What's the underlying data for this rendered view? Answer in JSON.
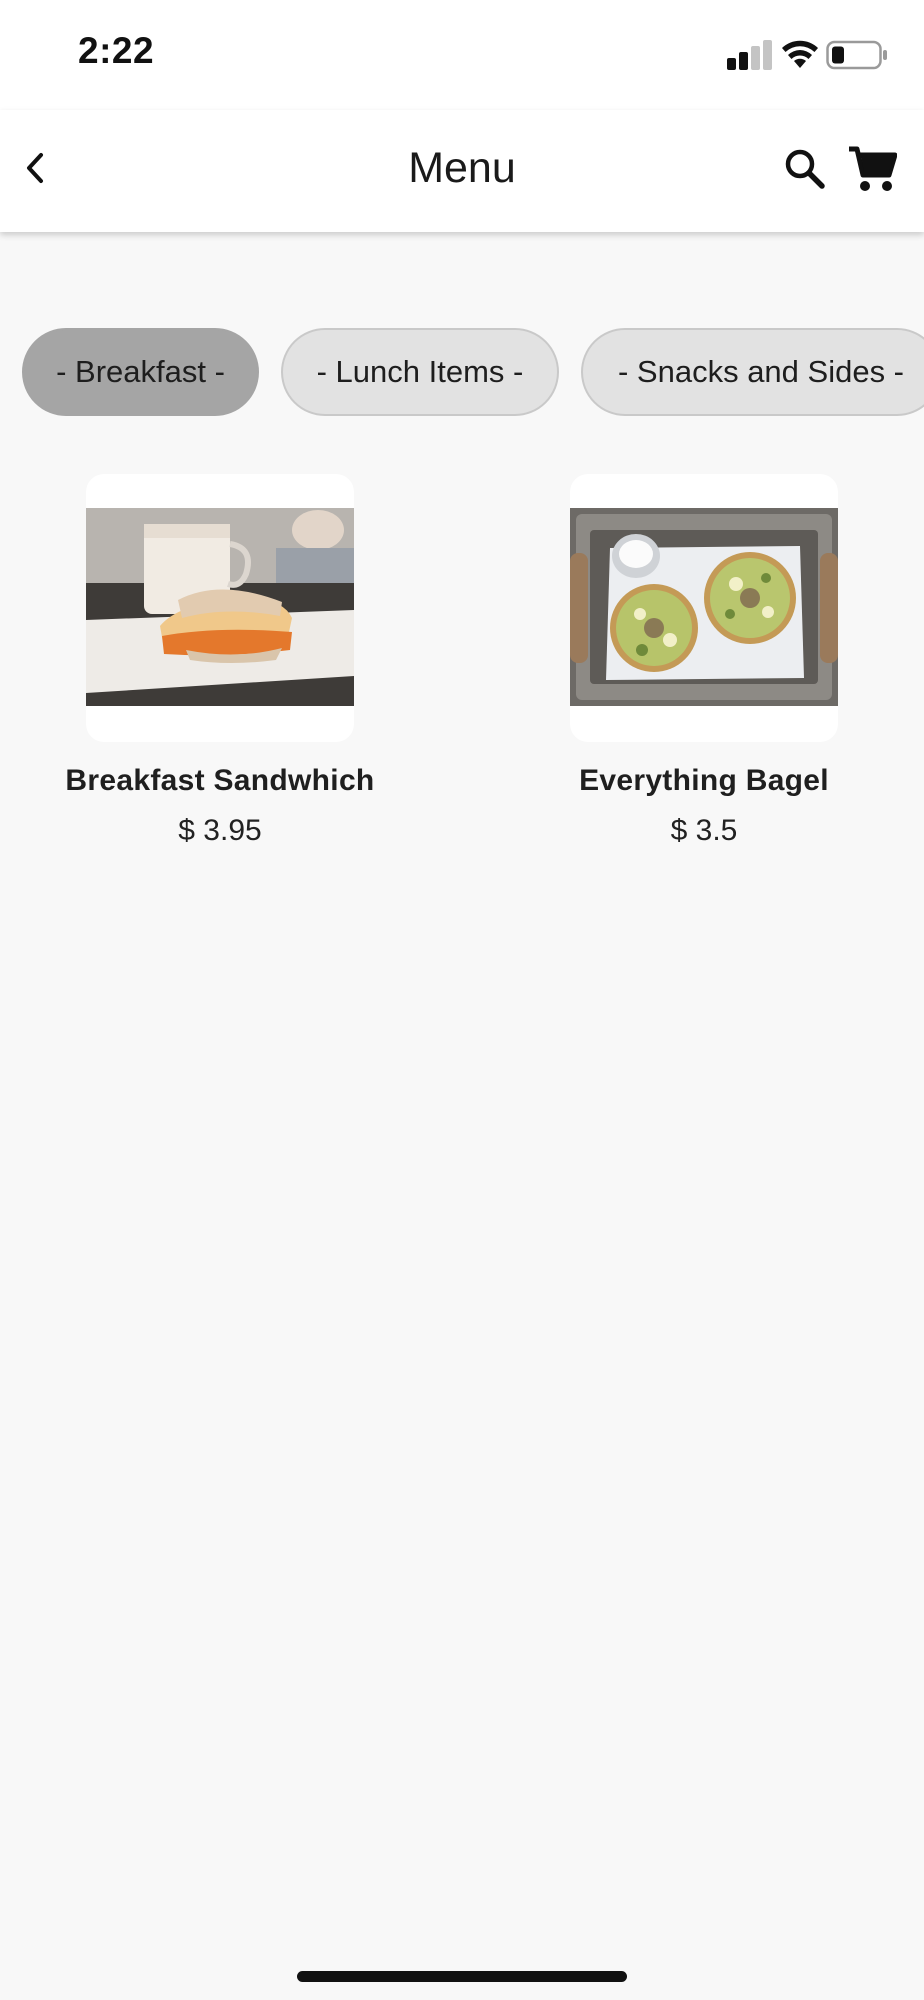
{
  "status_bar": {
    "time": "2:22",
    "signal_icon": "cellular-signal-icon",
    "wifi_icon": "wifi-icon",
    "battery_icon": "battery-low-icon"
  },
  "app_bar": {
    "title": "Menu",
    "back_icon": "chevron-left-icon",
    "search_icon": "search-icon",
    "cart_icon": "shopping-cart-icon"
  },
  "categories": [
    {
      "label": "- Breakfast -",
      "active": true
    },
    {
      "label": "- Lunch Items -",
      "active": false
    },
    {
      "label": "- Snacks and Sides -",
      "active": false
    }
  ],
  "items": [
    {
      "name": "Breakfast Sandwhich",
      "price": "$ 3.95"
    },
    {
      "name": "Everything Bagel",
      "price": "$ 3.5"
    }
  ],
  "colors": {
    "background": "#f8f8f8",
    "active_tab": "#a5a5a5",
    "inactive_tab": "#e2e2e2"
  }
}
